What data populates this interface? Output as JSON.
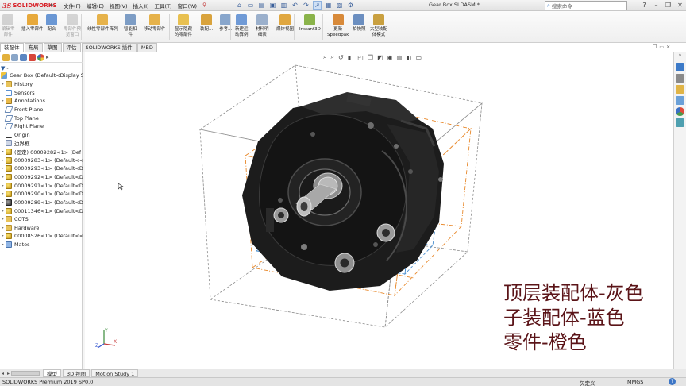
{
  "app": {
    "logo_prefix": "3S",
    "logo_name": "SOLIDWORKS",
    "menus": [
      "文件(F)",
      "编辑(E)",
      "视图(V)",
      "插入(I)",
      "工具(T)",
      "窗口(W)"
    ],
    "document_title": "Gear Box.SLDASM *",
    "search_placeholder": "搜索命令"
  },
  "ribbon": {
    "buttons": [
      {
        "label1": "编辑零",
        "label2": "部件",
        "enabled": false,
        "color": "#b9b9b9"
      },
      {
        "label1": "插入零部件",
        "label2": "",
        "enabled": true,
        "color": "#e7a93c"
      },
      {
        "label1": "配合",
        "label2": "",
        "enabled": true,
        "color": "#6a97d4"
      },
      {
        "label1": "零部件预",
        "label2": "览窗口",
        "enabled": false,
        "color": "#bcbcbc"
      },
      {
        "label1": "线性零部件阵列",
        "label2": "",
        "enabled": true,
        "color": "#e6b24a"
      },
      {
        "label1": "智能扣",
        "label2": "件",
        "enabled": true,
        "color": "#7d9dc5"
      },
      {
        "label1": "移动零部件",
        "label2": "",
        "enabled": true,
        "color": "#e6b24a"
      },
      {
        "label1": "显示隐藏",
        "label2": "的零部件",
        "enabled": true,
        "color": "#e8c050"
      },
      {
        "label1": "装配...",
        "label2": "",
        "enabled": true,
        "color": "#d9a33d"
      },
      {
        "label1": "参考...",
        "label2": "",
        "enabled": true,
        "color": "#88a6cc"
      },
      {
        "label1": "新建运",
        "label2": "动算例",
        "enabled": true,
        "color": "#6f9ad6"
      },
      {
        "label1": "材料明",
        "label2": "细表",
        "enabled": true,
        "color": "#9bb0cc"
      },
      {
        "label1": "爆炸视图",
        "label2": "",
        "enabled": true,
        "color": "#e0a740"
      },
      {
        "label1": "Instant3D",
        "label2": "",
        "enabled": true,
        "color": "#8ab34a"
      },
      {
        "label1": "更新",
        "label2": "Speedpak",
        "enabled": true,
        "color": "#d88a3a"
      },
      {
        "label1": "拍快照",
        "label2": "",
        "enabled": true,
        "color": "#6c8fc0"
      },
      {
        "label1": "大型装配",
        "label2": "体模式",
        "enabled": true,
        "color": "#c9a040"
      }
    ]
  },
  "command_tabs": [
    "装配体",
    "布局",
    "草图",
    "评估",
    "SOLIDWORKS 插件",
    "MBD"
  ],
  "feature_tree": {
    "root": "Gear Box  (Default<Display S",
    "nodes": [
      {
        "label": "History",
        "icon": "folder-icon",
        "expandable": true
      },
      {
        "label": "Sensors",
        "icon": "sensor-icon",
        "expandable": false
      },
      {
        "label": "Annotations",
        "icon": "annotation-icon",
        "expandable": true
      },
      {
        "label": "Front Plane",
        "icon": "plane-icon",
        "expandable": false
      },
      {
        "label": "Top Plane",
        "icon": "plane-icon",
        "expandable": false
      },
      {
        "label": "Right Plane",
        "icon": "plane-icon",
        "expandable": false
      },
      {
        "label": "Origin",
        "icon": "origin-icon",
        "expandable": false
      },
      {
        "label": "边界框",
        "icon": "bounding-box-icon",
        "expandable": false
      },
      {
        "label": "(固定) 00009282<1> (Def",
        "icon": "part-icon",
        "expandable": true
      },
      {
        "label": "00009283<1> (Default<<",
        "icon": "part-icon",
        "expandable": true
      },
      {
        "label": "00009293<1> (Default<D",
        "icon": "part-icon",
        "expandable": true
      },
      {
        "label": "00009292<1> (Default<D",
        "icon": "part-icon",
        "expandable": true
      },
      {
        "label": "00009291<1> (Default<D",
        "icon": "part-icon",
        "expandable": true
      },
      {
        "label": "00009290<1> (Default<D",
        "icon": "part-icon",
        "expandable": true
      },
      {
        "label": "00009289<1> (Default<D",
        "icon": "part-dark-icon",
        "expandable": true
      },
      {
        "label": "00011346<1> (Default<D",
        "icon": "part-icon",
        "expandable": true
      },
      {
        "label": "COTS",
        "icon": "folder-icon",
        "expandable": true
      },
      {
        "label": "Hardware",
        "icon": "folder-icon",
        "expandable": true
      },
      {
        "label": "00008526<1> (Default<<",
        "icon": "part-icon",
        "expandable": true
      },
      {
        "label": "Mates",
        "icon": "mates-icon",
        "expandable": true
      }
    ]
  },
  "bottom_tabs": [
    "模型",
    "3D 视图",
    "Motion Study 1"
  ],
  "status": {
    "version": "SOLIDWORKS Premium 2019 SP0.0",
    "state": "欠定义",
    "units": "MMGS",
    "help": "?"
  },
  "caption": {
    "line1": "顶层装配体-灰色",
    "line2": "子装配体-蓝色",
    "line3": "零件-橙色"
  },
  "colors": {
    "top_assembly_box": "#8a8a8a",
    "sub_assembly_box": "#4a8fcf",
    "part_box": "#e8882a",
    "caption_text": "#5b1418",
    "logo_red": "#d8232a"
  }
}
